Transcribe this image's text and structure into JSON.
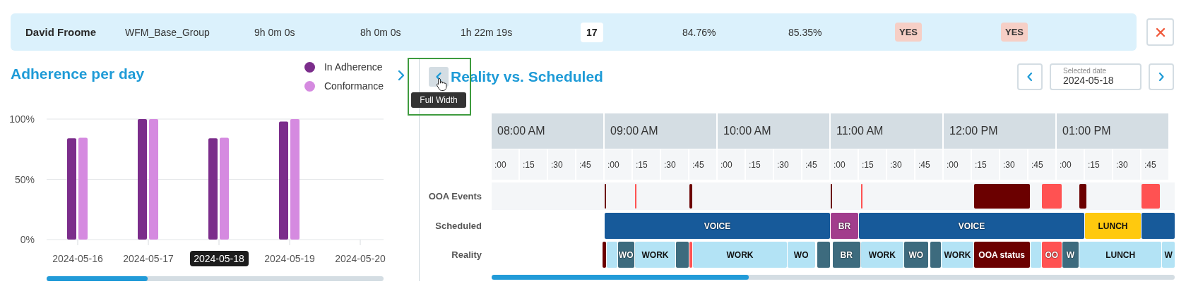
{
  "agent_row": {
    "name": "David Froome",
    "cells": [
      {
        "kind": "text",
        "text": "WFM_Base_Group"
      },
      {
        "kind": "text",
        "text": "9h 0m 0s"
      },
      {
        "kind": "text",
        "text": "8h 0m 0s"
      },
      {
        "kind": "text",
        "text": "1h 22m 19s"
      },
      {
        "kind": "count",
        "text": "17"
      },
      {
        "kind": "text",
        "text": "84.76%"
      },
      {
        "kind": "text",
        "text": "85.35%"
      },
      {
        "kind": "flag",
        "text": "YES"
      },
      {
        "kind": "flag",
        "text": "YES"
      }
    ]
  },
  "adherence_panel": {
    "title": "Adherence per day",
    "chart_data": {
      "type": "bar",
      "categories": [
        "2024-05-16",
        "2024-05-17",
        "2024-05-18",
        "2024-05-19",
        "2024-05-20"
      ],
      "series": [
        {
          "name": "In Adherence",
          "color": "#7b2d8b",
          "values": [
            84,
            100,
            84,
            98,
            null
          ]
        },
        {
          "name": "Conformance",
          "color": "#d58ae0",
          "values": [
            84.5,
            100,
            84.5,
            100,
            null
          ]
        }
      ],
      "ylim": [
        0,
        100
      ],
      "yticks": [
        {
          "value": 0,
          "label": "0%"
        },
        {
          "value": 50,
          "label": "50%"
        },
        {
          "value": 100,
          "label": "100%"
        }
      ]
    }
  },
  "reality_panel": {
    "title": "Reality vs. Scheduled",
    "tooltip": "Full Width",
    "date_picker": {
      "label": "Selected date",
      "value": "2024-05-18"
    },
    "timeline": {
      "hours": [
        {
          "label": "08:00 AM",
          "quarters": [
            ":00",
            ":15",
            ":30",
            ":45"
          ]
        },
        {
          "label": "09:00 AM",
          "quarters": [
            ":00",
            ":15",
            ":30",
            ":45"
          ]
        },
        {
          "label": "10:00 AM",
          "quarters": [
            ":00",
            ":15",
            ":30",
            ":45"
          ]
        },
        {
          "label": "11:00 AM",
          "quarters": [
            ":00",
            ":15",
            ":30",
            ":45"
          ]
        },
        {
          "label": "12:00 PM",
          "quarters": [
            ":00",
            ":15",
            ":30",
            ":45"
          ]
        },
        {
          "label": "01:00 PM",
          "quarters": [
            ":00",
            ":15",
            ":30",
            ":45"
          ]
        }
      ],
      "rows": [
        {
          "label": "OOA Events",
          "kind": "events",
          "segments": [
            {
              "kind": "ooa"
            },
            {
              "kind": "oo"
            },
            {
              "kind": "ooa"
            },
            {
              "kind": "ooa"
            },
            {
              "kind": "oo"
            },
            {
              "kind": "ooa"
            },
            {
              "kind": "oo"
            },
            {
              "kind": "ooa"
            },
            {
              "kind": "oo"
            }
          ]
        },
        {
          "label": "Scheduled",
          "kind": "bars",
          "segments": [
            {
              "kind": "voice",
              "label": "VOICE"
            },
            {
              "kind": "break",
              "label": "BR"
            },
            {
              "kind": "voice",
              "label": "VOICE"
            },
            {
              "kind": "lunch",
              "label": "LUNCH"
            },
            {
              "kind": "voice"
            }
          ]
        },
        {
          "label": "Reality",
          "kind": "bars",
          "segments": [
            {
              "kind": "ooa"
            },
            {
              "kind": "work"
            },
            {
              "kind": "idle",
              "label": "WO"
            },
            {
              "kind": "work",
              "label": "WORK"
            },
            {
              "kind": "idle"
            },
            {
              "kind": "oo"
            },
            {
              "kind": "work",
              "label": "WORK"
            },
            {
              "kind": "work",
              "label": "WO"
            },
            {
              "kind": "idle"
            },
            {
              "kind": "idle",
              "label": "BR"
            },
            {
              "kind": "work",
              "label": "WORK"
            },
            {
              "kind": "idle",
              "label": "WO"
            },
            {
              "kind": "idle"
            },
            {
              "kind": "work",
              "label": "WORK"
            },
            {
              "kind": "ooa",
              "label": "OOA status"
            },
            {
              "kind": "work"
            },
            {
              "kind": "oo",
              "label": "OO"
            },
            {
              "kind": "idle",
              "label": "W"
            },
            {
              "kind": "work",
              "label": "LUNCH"
            },
            {
              "kind": "work",
              "label": "W"
            }
          ]
        }
      ]
    }
  }
}
